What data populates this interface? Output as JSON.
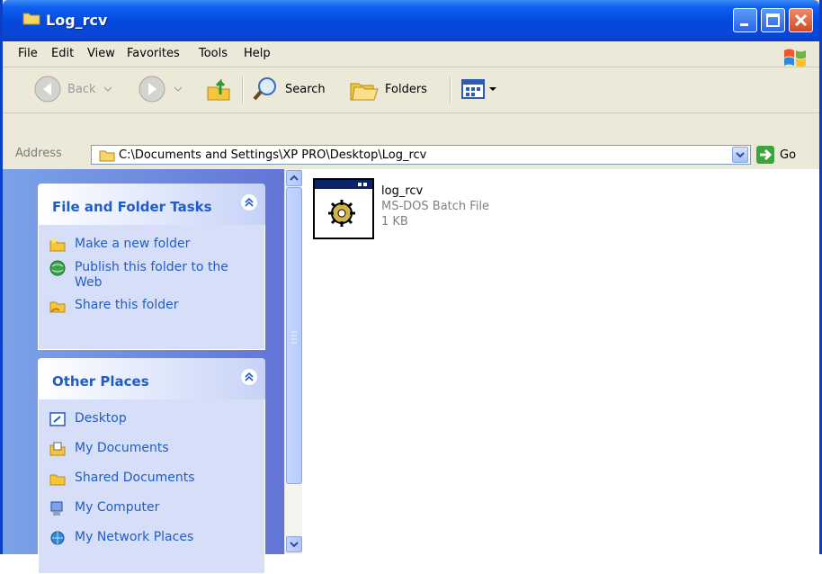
{
  "window": {
    "title": "Log_rcv"
  },
  "menu": [
    "File",
    "Edit",
    "View",
    "Favorites",
    "Tools",
    "Help"
  ],
  "toolbar": {
    "back": "Back",
    "search": "Search",
    "folders": "Folders"
  },
  "address": {
    "label": "Address",
    "path": "C:\\Documents and Settings\\XP PRO\\Desktop\\Log_rcv",
    "go": "Go"
  },
  "tasks_panel": {
    "title": "File and Folder Tasks",
    "items": [
      "Make a new folder",
      "Publish this folder to the Web",
      "Share this folder"
    ]
  },
  "places_panel": {
    "title": "Other Places",
    "items": [
      "Desktop",
      "My Documents",
      "Shared Documents",
      "My Computer",
      "My Network Places"
    ]
  },
  "file": {
    "name": "log_rcv",
    "type": "MS-DOS Batch File",
    "size": "1 KB"
  }
}
